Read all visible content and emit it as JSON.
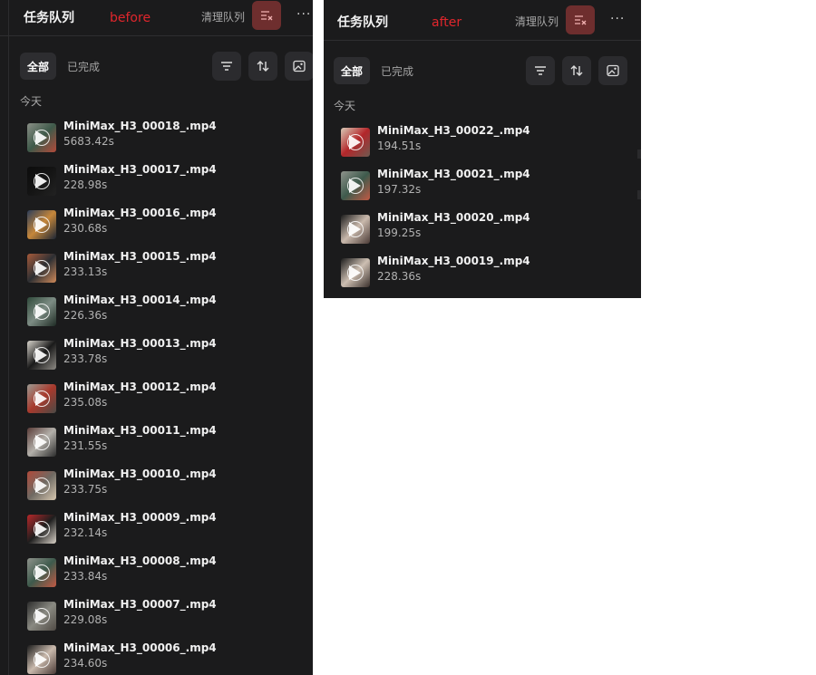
{
  "before": {
    "title": "任务队列",
    "annotation": "before",
    "clear_label": "清理队列",
    "more_label": "···",
    "tabs": {
      "all": "全部",
      "done": "已完成"
    },
    "tools": [
      "filter-icon",
      "sort-icon",
      "image-icon"
    ],
    "section": "今天",
    "items": [
      {
        "name": "MiniMax_H3_00018_.mp4",
        "duration": "5683.42s",
        "thumb_colors": [
          "#8a8f86",
          "#3f5a4a",
          "#b34a3a"
        ]
      },
      {
        "name": "MiniMax_H3_00017_.mp4",
        "duration": "228.98s",
        "thumb_colors": [
          "#0c0c0c",
          "#141414",
          "#222222"
        ]
      },
      {
        "name": "MiniMax_H3_00016_.mp4",
        "duration": "230.68s",
        "thumb_colors": [
          "#2b3d5a",
          "#c6873a",
          "#1c2636"
        ]
      },
      {
        "name": "MiniMax_H3_00015_.mp4",
        "duration": "233.13s",
        "thumb_colors": [
          "#a65a3a",
          "#2d2f33",
          "#d08a5a"
        ]
      },
      {
        "name": "MiniMax_H3_00014_.mp4",
        "duration": "226.36s",
        "thumb_colors": [
          "#2f4a3a",
          "#7d8c84",
          "#1e2b24"
        ]
      },
      {
        "name": "MiniMax_H3_00013_.mp4",
        "duration": "233.78s",
        "thumb_colors": [
          "#d8d4cc",
          "#1a1a1a",
          "#8d8a84"
        ]
      },
      {
        "name": "MiniMax_H3_00012_.mp4",
        "duration": "235.08s",
        "thumb_colors": [
          "#9c9a92",
          "#a8392c",
          "#4a4a46"
        ]
      },
      {
        "name": "MiniMax_H3_00011_.mp4",
        "duration": "231.55s",
        "thumb_colors": [
          "#5a3c38",
          "#b3b0aa",
          "#2b2b2b"
        ]
      },
      {
        "name": "MiniMax_H3_00010_.mp4",
        "duration": "233.75s",
        "thumb_colors": [
          "#b04a3a",
          "#6f6a63",
          "#d8c8b0"
        ]
      },
      {
        "name": "MiniMax_H3_00009_.mp4",
        "duration": "232.14s",
        "thumb_colors": [
          "#b8282a",
          "#1e1e1e",
          "#d9d2c8"
        ]
      },
      {
        "name": "MiniMax_H3_00008_.mp4",
        "duration": "233.84s",
        "thumb_colors": [
          "#8f938c",
          "#3e5a4c",
          "#c25a45"
        ]
      },
      {
        "name": "MiniMax_H3_00007_.mp4",
        "duration": "229.08s",
        "thumb_colors": [
          "#2c2c2c",
          "#8a8a82",
          "#4f4a44"
        ]
      },
      {
        "name": "MiniMax_H3_00006_.mp4",
        "duration": "234.60s",
        "thumb_colors": [
          "#1b1b1b",
          "#c9b9ac",
          "#4a3a36"
        ]
      }
    ]
  },
  "after": {
    "title": "任务队列",
    "annotation": "after",
    "clear_label": "清理队列",
    "more_label": "···",
    "tabs": {
      "all": "全部",
      "done": "已完成"
    },
    "tools": [
      "filter-icon",
      "sort-icon",
      "image-icon"
    ],
    "section": "今天",
    "items": [
      {
        "name": "MiniMax_H3_00022_.mp4",
        "duration": "194.51s",
        "thumb_colors": [
          "#d9cbb8",
          "#b3262a",
          "#6e5a50"
        ]
      },
      {
        "name": "MiniMax_H3_00021_.mp4",
        "duration": "197.32s",
        "thumb_colors": [
          "#8f938c",
          "#3e5a4c",
          "#c25a45"
        ]
      },
      {
        "name": "MiniMax_H3_00020_.mp4",
        "duration": "199.25s",
        "thumb_colors": [
          "#1b1b1b",
          "#c9b9ac",
          "#4a3a36"
        ]
      },
      {
        "name": "MiniMax_H3_00019_.mp4",
        "duration": "228.36s",
        "thumb_colors": [
          "#1b1b1b",
          "#cdbfb2",
          "#3a302c"
        ]
      }
    ]
  },
  "colors": {
    "panel_bg": "#1b1b1c",
    "clear_btn_bg": "#6e2e2e",
    "annotation_red": "#e0262c",
    "tool_btn_bg": "#2b2b2e"
  }
}
